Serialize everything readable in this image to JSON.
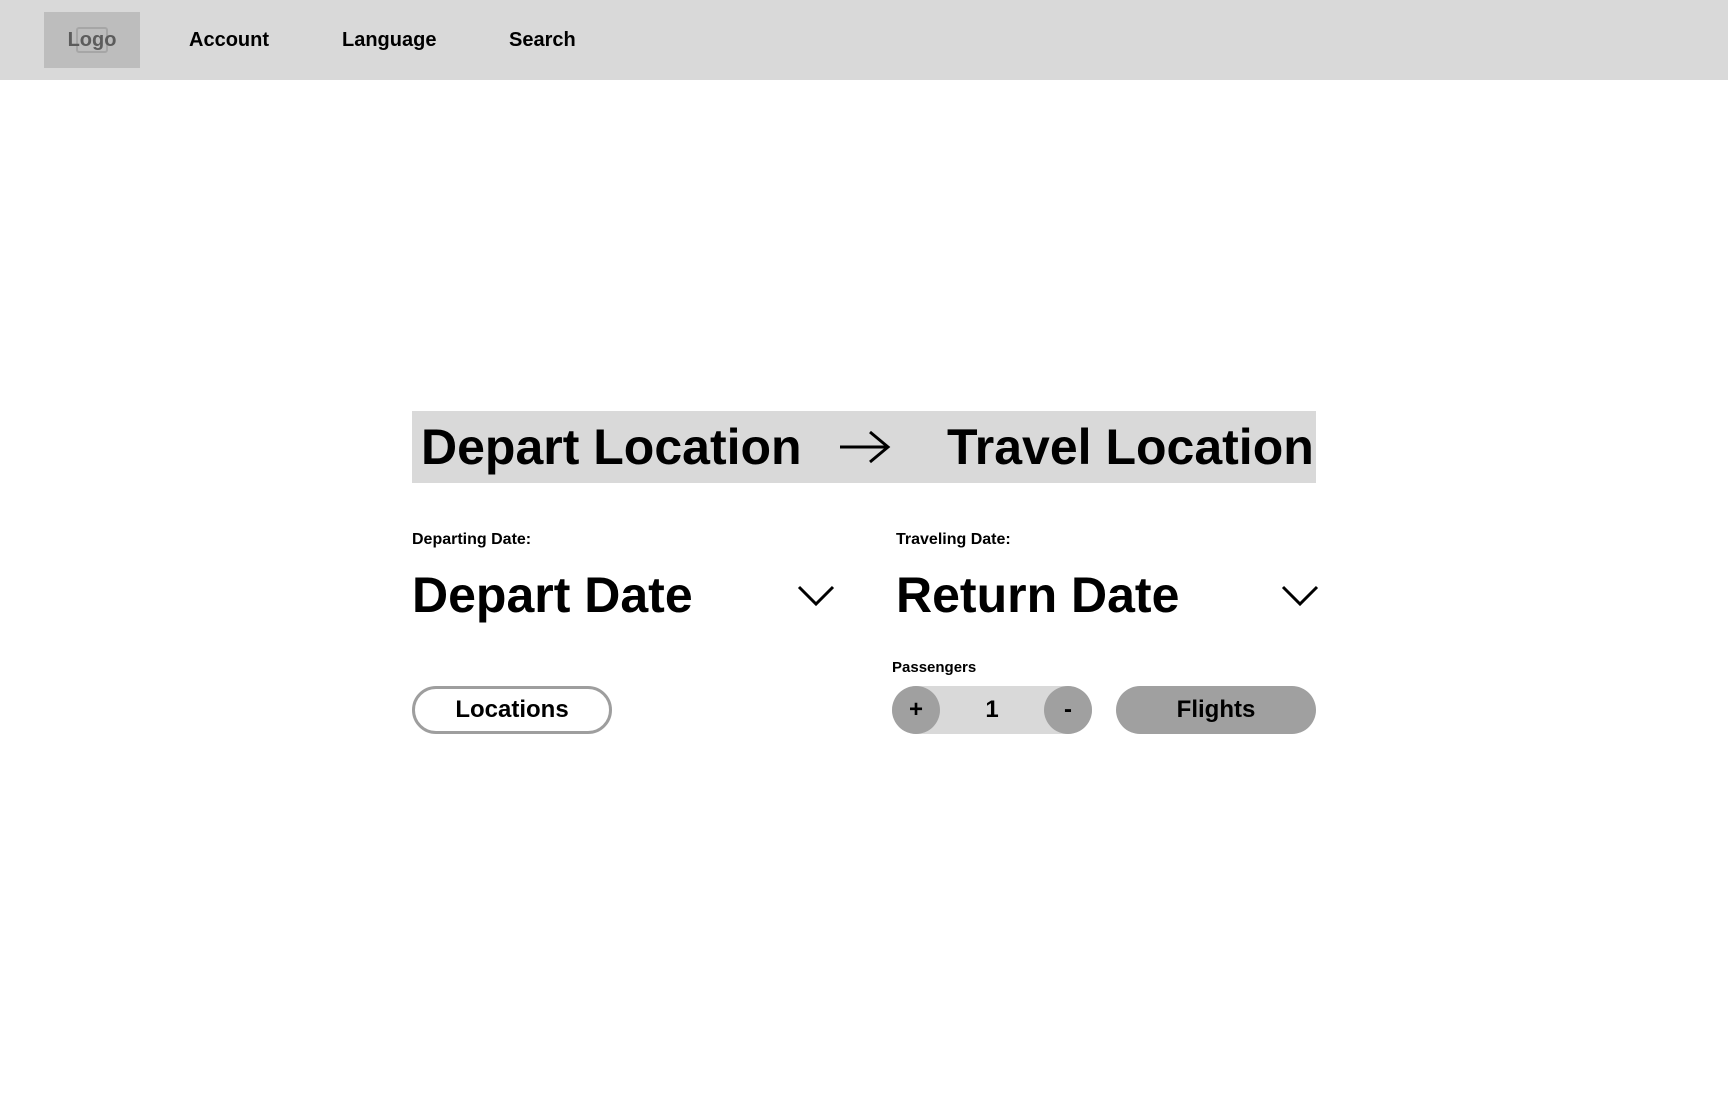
{
  "navbar": {
    "logo_label": "Logo",
    "links": [
      "Account",
      "Language",
      "Search"
    ]
  },
  "route": {
    "depart_location": "Depart Location",
    "arrow_icon": "right-arrow-icon",
    "travel_location": "Travel Location"
  },
  "dates": {
    "departing_label": "Departing Date:",
    "depart_value": "Depart Date",
    "traveling_label": "Traveling Date:",
    "return_value": "Return Date"
  },
  "passengers": {
    "label": "Passengers",
    "increment": "+",
    "value": "1",
    "decrement": "-"
  },
  "actions": {
    "locations_label": "Locations",
    "flights_label": "Flights"
  },
  "colors": {
    "navbar_bg": "#d9d9d9",
    "logo_bg": "#bdbdbd",
    "button_fill": "#a0a0a0",
    "outline": "#9e9e9e"
  }
}
